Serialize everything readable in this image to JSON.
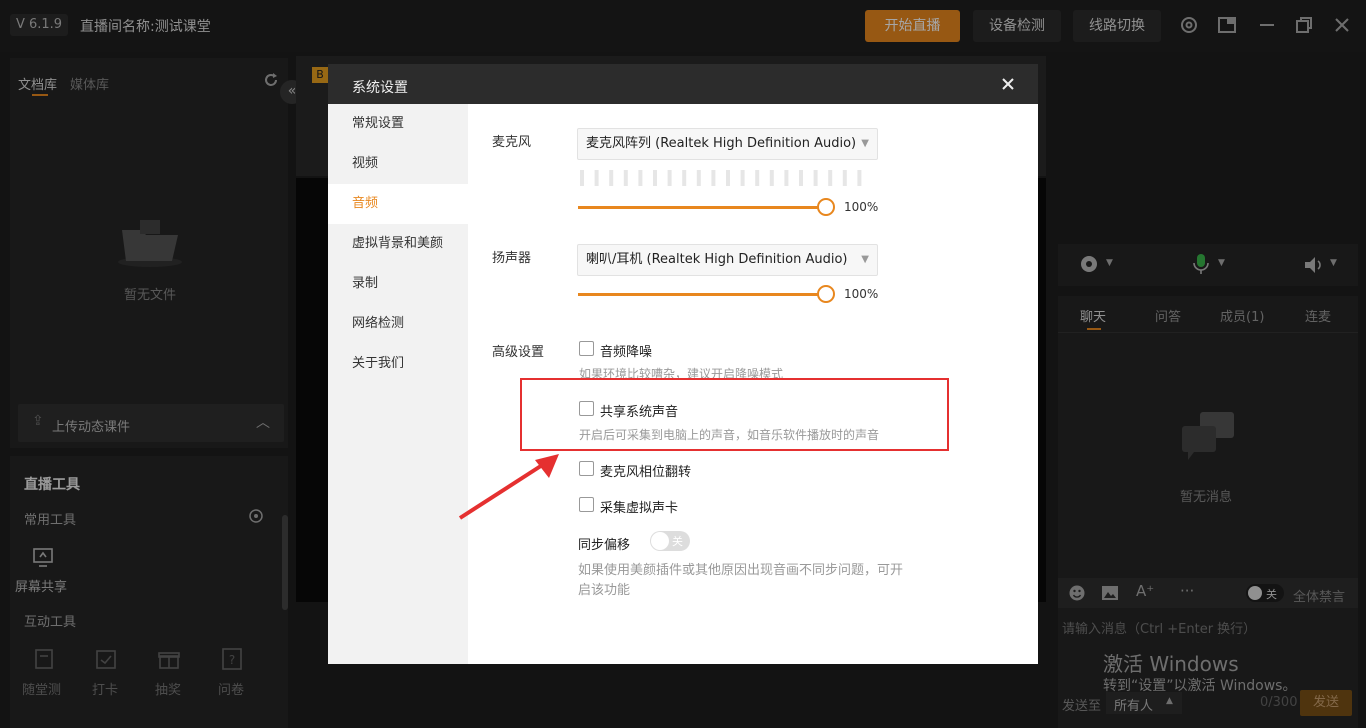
{
  "top": {
    "version": "V 6.1.9",
    "room_name": "直播间名称:测试课堂",
    "start_live": "开始直播",
    "device_check": "设备检测",
    "line_switch": "线路切换"
  },
  "left": {
    "tab_docs": "文档库",
    "tab_media": "媒体库",
    "empty_text": "暂无文件",
    "upload_label": "上传动态课件",
    "tools_title": "直播工具",
    "common_tools": "常用工具",
    "screen_share": "屏幕共享",
    "interactive_tools": "互动工具",
    "tools": [
      "随堂测",
      "打卡",
      "抽奖",
      "问卷"
    ]
  },
  "right": {
    "tabs": [
      "聊天",
      "问答",
      "成员(1)",
      "连麦"
    ],
    "empty_msg": "暂无消息",
    "mute_toggle": "关",
    "mute_all": "全体禁言",
    "input_placeholder": "请输入消息（Ctrl +Enter 换行）",
    "send_to_label": "发送至",
    "send_to_value": "所有人",
    "counter": "0/300",
    "send": "发送",
    "activate_title": "激活 Windows",
    "activate_sub": "转到“设置”以激活 Windows。"
  },
  "center": {
    "badge": "B"
  },
  "dialog": {
    "title": "系统设置",
    "nav": [
      "常规设置",
      "视频",
      "音频",
      "虚拟背景和美颜",
      "录制",
      "网络检测",
      "关于我们"
    ],
    "active_nav_index": 2,
    "mic_label": "麦克风",
    "mic_device": "麦克风阵列 (Realtek High Definition Audio)",
    "mic_volume": "100%",
    "speaker_label": "扬声器",
    "speaker_device": "喇叭/耳机 (Realtek High Definition Audio)",
    "speaker_volume": "100%",
    "advanced_label": "高级设置",
    "noise_reduction": "音频降噪",
    "noise_desc": "如果环境比较嘈杂，建议开启降噪模式",
    "share_sound": "共享系统声音",
    "share_desc": "开启后可采集到电脑上的声音，如音乐软件播放时的声音",
    "mic_phase": "麦克风相位翻转",
    "virtual_card": "采集虚拟声卡",
    "sync_offset": "同步偏移",
    "sync_toggle": "关",
    "sync_desc_1": "如果使用美颜插件或其他原因出现音画不同步问题，可开",
    "sync_desc_2": "启该功能"
  },
  "colors": {
    "accent": "#e8871e",
    "annotation": "#e53030"
  }
}
